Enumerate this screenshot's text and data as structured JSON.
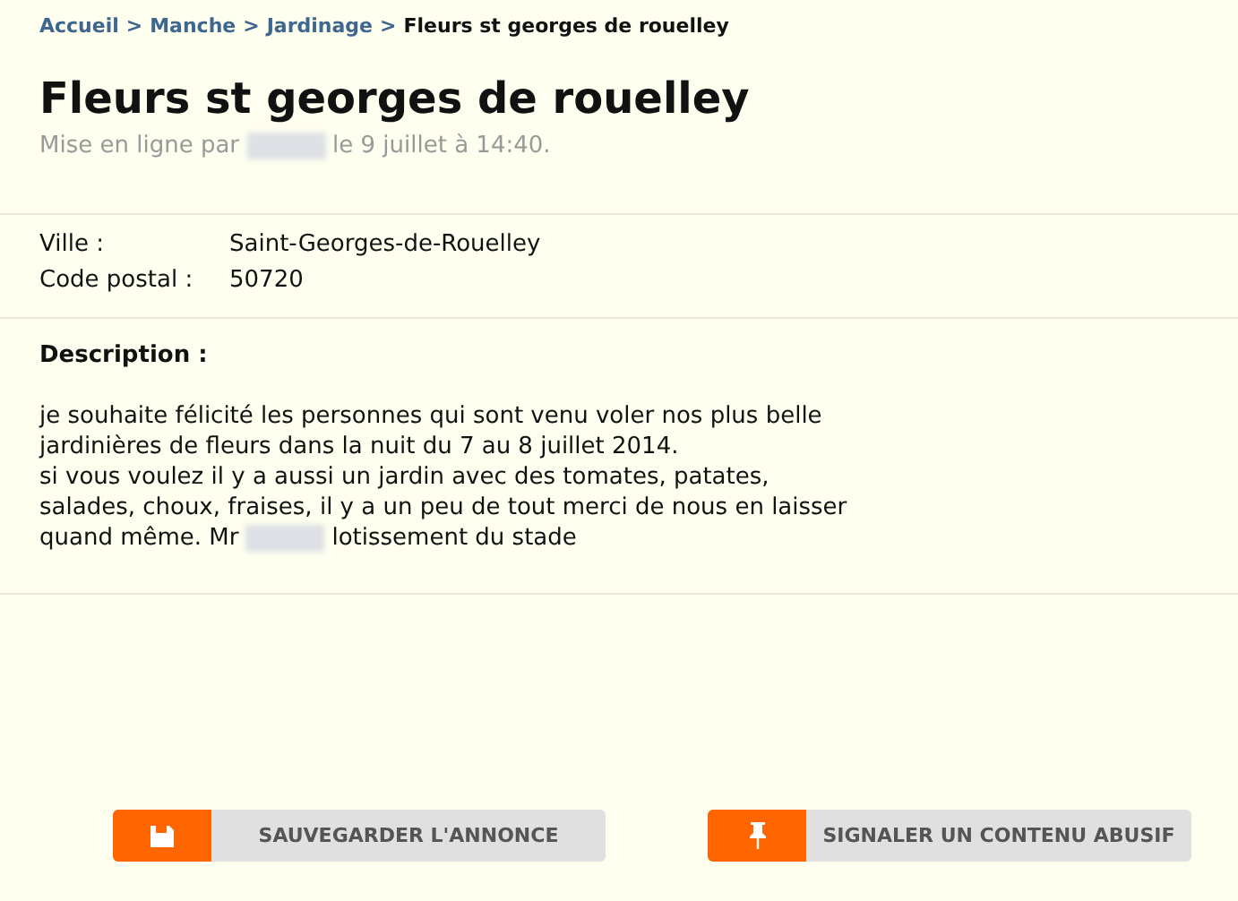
{
  "breadcrumb": [
    {
      "label": "Accueil",
      "kind": "link"
    },
    {
      "label": "Manche",
      "kind": "link"
    },
    {
      "label": "Jardinage",
      "kind": "link"
    },
    {
      "label": "Fleurs st georges de rouelley",
      "kind": "current"
    }
  ],
  "breadcrumb_separator": ">",
  "title": "Fleurs st georges de rouelley",
  "meta": [
    {
      "kind": "text",
      "text": "Mise en ligne par"
    },
    {
      "kind": "redacted"
    },
    {
      "kind": "text",
      "text": "le 9 juillet à 14:40."
    }
  ],
  "details": [
    {
      "label": "Ville :",
      "value": "Saint-Georges-de-Rouelley"
    },
    {
      "label": "Code postal :",
      "value": "50720"
    }
  ],
  "description_heading": "Description :",
  "description_lines": [
    [
      {
        "kind": "text",
        "text": "je souhaite félicité les personnes qui sont venu voler nos plus belle"
      }
    ],
    [
      {
        "kind": "text",
        "text": "jardinières de fleurs dans la nuit du 7 au 8 juillet 2014."
      }
    ],
    [
      {
        "kind": "text",
        "text": "si vous voulez il y a aussi un jardin avec des tomates, patates,"
      }
    ],
    [
      {
        "kind": "text",
        "text": "salades, choux, fraises, il y a un peu de tout merci de nous en laisser"
      }
    ],
    [
      {
        "kind": "text",
        "text": "quand même. Mr"
      },
      {
        "kind": "redacted"
      },
      {
        "kind": "text",
        "text": "lotissement du stade"
      }
    ]
  ],
  "actions": [
    {
      "label": "SAUVEGARDER L'ANNONCE",
      "kind": "save"
    },
    {
      "label": "SIGNALER UN CONTENU ABUSIF",
      "kind": "report"
    }
  ]
}
